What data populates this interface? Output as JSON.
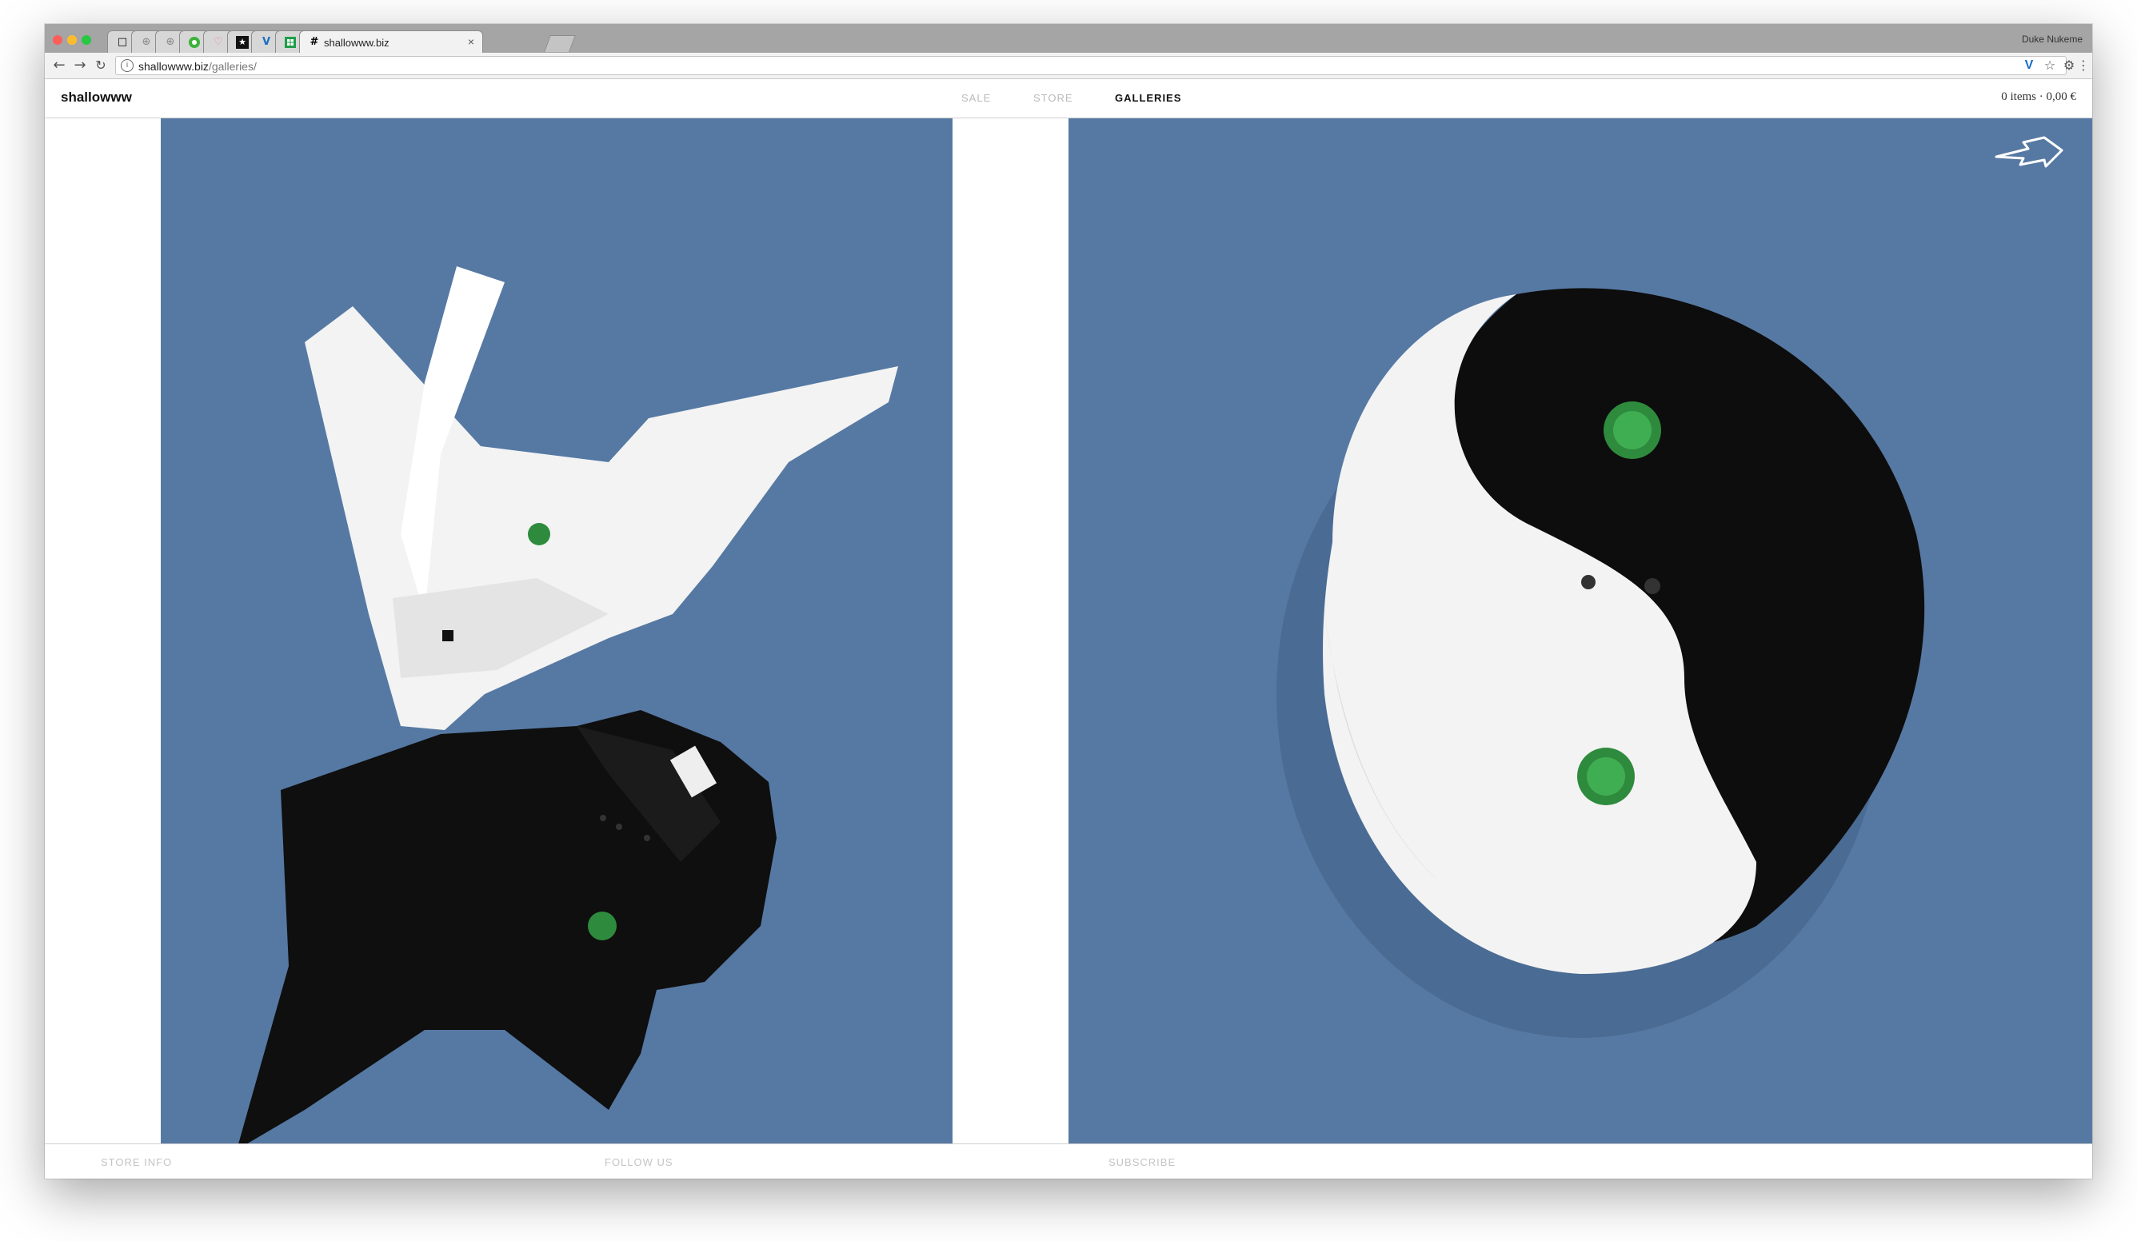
{
  "browser": {
    "profile_name": "Duke Nukeme",
    "tabs": [
      {
        "icon": "blank-page-icon"
      },
      {
        "icon": "blank-tab-icon"
      },
      {
        "icon": "blank-tab-icon"
      },
      {
        "icon": "green-circle-icon"
      },
      {
        "icon": "heart-icon"
      },
      {
        "icon": "star-app-icon"
      },
      {
        "icon": "v-app-icon"
      },
      {
        "icon": "sheet-app-icon"
      },
      {
        "icon": "hash-icon",
        "title": "shallowww.biz",
        "active": true
      }
    ],
    "url_host": "shallowww.biz",
    "url_path": "/galleries/"
  },
  "site": {
    "logo": "shallowww",
    "nav": [
      {
        "label": "SALE",
        "active": false
      },
      {
        "label": "STORE",
        "active": false
      },
      {
        "label": "GALLERIES",
        "active": true
      }
    ],
    "cart": "0 items · 0,00 €"
  },
  "gallery": {
    "background_color": "#5679a3",
    "images": [
      {
        "subject": "white and black polo shirts with frog patch, laid flat"
      },
      {
        "subject": "white and black polo shirts twisted into yin-yang shape"
      }
    ]
  },
  "footer": {
    "links": [
      "STORE INFO",
      "FOLLOW US",
      "SUBSCRIBE"
    ]
  }
}
